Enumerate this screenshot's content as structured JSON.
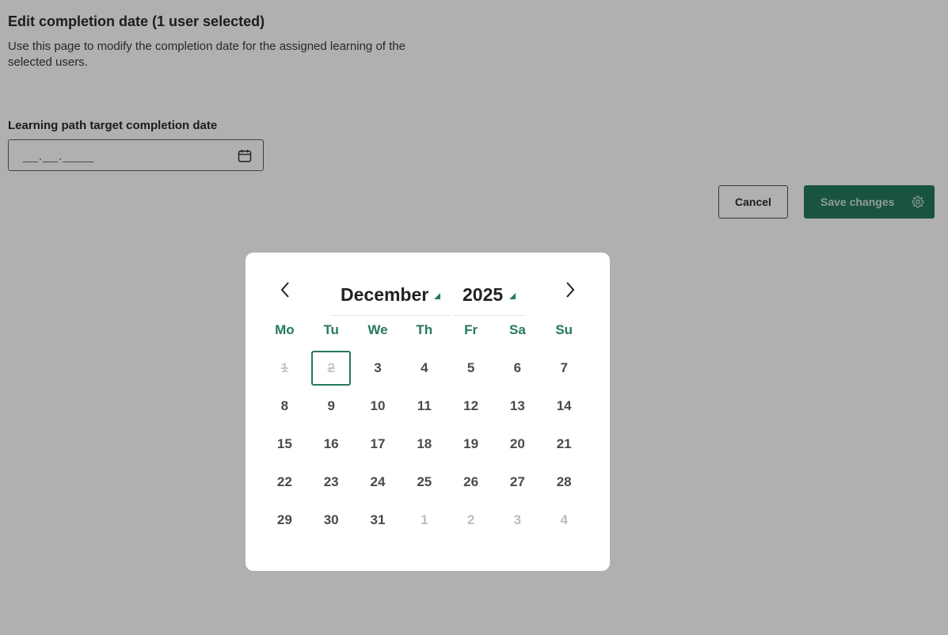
{
  "page": {
    "title": "Edit completion date (1 user selected)",
    "description": "Use this page to modify the completion date for the assigned learning of the selected users.",
    "field_label": "Learning path target completion date",
    "date_input": {
      "value": "__.__.____",
      "icon": "calendar-icon"
    },
    "cancel_label": "Cancel",
    "save_label": "Save changes",
    "save_icon": "gear-icon"
  },
  "datepicker": {
    "month": "December",
    "year": "2025",
    "prev_icon": "chevron-left-icon",
    "next_icon": "chevron-right-icon",
    "weekdays": [
      "Mo",
      "Tu",
      "We",
      "Th",
      "Fr",
      "Sa",
      "Su"
    ],
    "weeks": [
      [
        {
          "d": "1",
          "state": "disabled"
        },
        {
          "d": "2",
          "state": "disabled-today"
        },
        {
          "d": "3"
        },
        {
          "d": "4"
        },
        {
          "d": "5"
        },
        {
          "d": "6"
        },
        {
          "d": "7"
        }
      ],
      [
        {
          "d": "8"
        },
        {
          "d": "9"
        },
        {
          "d": "10"
        },
        {
          "d": "11"
        },
        {
          "d": "12"
        },
        {
          "d": "13"
        },
        {
          "d": "14"
        }
      ],
      [
        {
          "d": "15"
        },
        {
          "d": "16"
        },
        {
          "d": "17"
        },
        {
          "d": "18"
        },
        {
          "d": "19"
        },
        {
          "d": "20"
        },
        {
          "d": "21"
        }
      ],
      [
        {
          "d": "22"
        },
        {
          "d": "23"
        },
        {
          "d": "24"
        },
        {
          "d": "25"
        },
        {
          "d": "26"
        },
        {
          "d": "27"
        },
        {
          "d": "28"
        }
      ],
      [
        {
          "d": "29"
        },
        {
          "d": "30"
        },
        {
          "d": "31"
        },
        {
          "d": "1",
          "state": "outside"
        },
        {
          "d": "2",
          "state": "outside"
        },
        {
          "d": "3",
          "state": "outside"
        },
        {
          "d": "4",
          "state": "outside"
        }
      ]
    ]
  },
  "colors": {
    "accent": "#257a5a",
    "overlay": "rgba(0,0,0,0.31)"
  }
}
